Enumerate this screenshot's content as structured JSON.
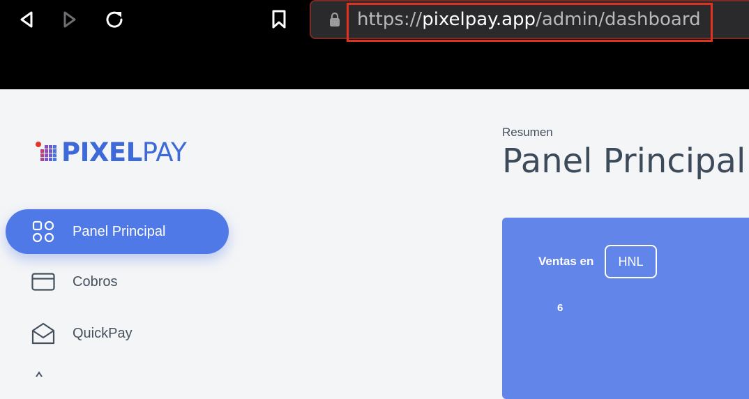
{
  "browser": {
    "url_scheme": "https://",
    "url_host": "pixelpay.app",
    "url_path": "/admin/dashboard"
  },
  "logo": {
    "part1": "PIXEL",
    "part2": "PAY",
    "brand_color": "#3e6ad9"
  },
  "sidebar": {
    "items": [
      {
        "label": "Panel Principal",
        "icon": "grid-icon",
        "active": true
      },
      {
        "label": "Cobros",
        "icon": "credit-card-icon",
        "active": false
      },
      {
        "label": "QuickPay",
        "icon": "envelope-icon",
        "active": false
      }
    ]
  },
  "header": {
    "breadcrumb": "Resumen",
    "title": "Panel Principal"
  },
  "sales_card": {
    "label": "Ventas en",
    "currency": "HNL",
    "axis_tick": "6",
    "color": "#6285ea"
  }
}
